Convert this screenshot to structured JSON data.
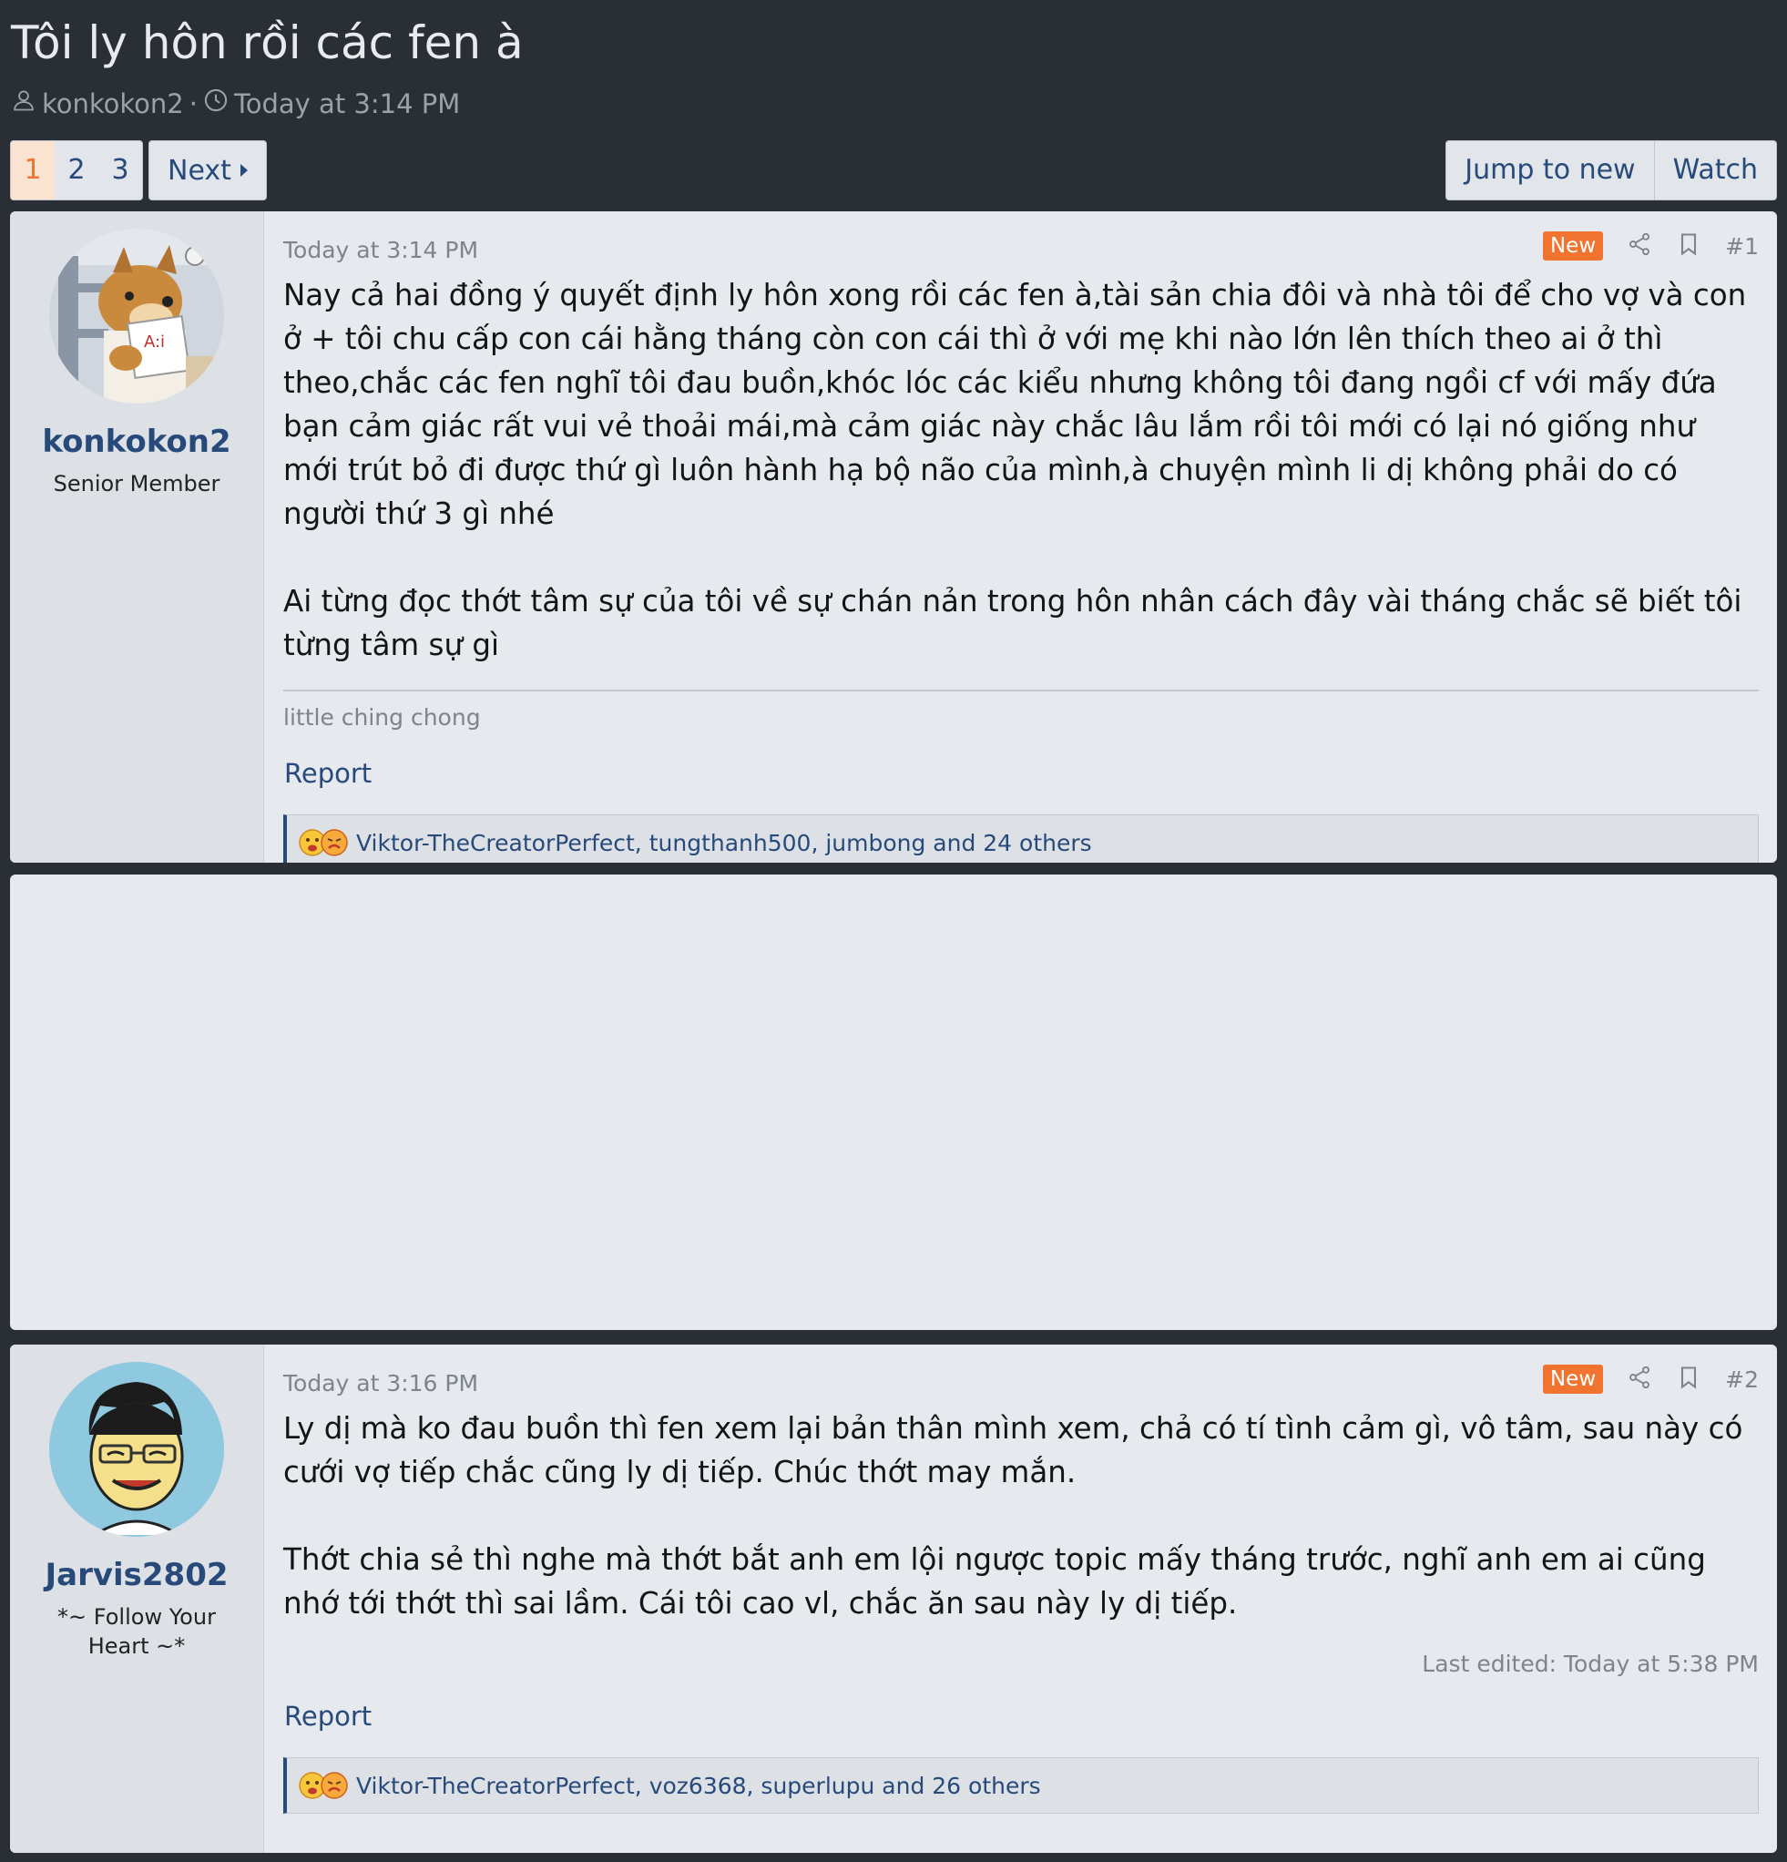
{
  "thread": {
    "title": "Tôi ly hôn rồi các fen à",
    "author": "konkokon2",
    "separator": "·",
    "time": "Today at 3:14 PM"
  },
  "pagination": {
    "pages": [
      "1",
      "2",
      "3"
    ],
    "current": "1",
    "next_label": "Next"
  },
  "actions": {
    "jump_label": "Jump to new",
    "watch_label": "Watch"
  },
  "posts": [
    {
      "username": "konkokon2",
      "user_title": "Senior Member",
      "date": "Today at 3:14 PM",
      "badge": "New",
      "number": "#1",
      "paragraphs": [
        "Nay cả hai đồng ý quyết định ly hôn xong rồi các fen à,tài sản chia đôi và nhà tôi để cho vợ và con ở + tôi chu cấp con cái hằng tháng còn con cái thì ở với mẹ khi nào lớn lên thích theo ai ở thì theo,chắc các fen nghĩ tôi đau buồn,khóc lóc các kiểu nhưng không tôi đang ngồi cf với mấy đứa bạn cảm giác rất vui vẻ thoải mái,mà cảm giác này chắc lâu lắm rồi tôi mới có lại nó giống như mới trút bỏ đi được thứ gì luôn hành hạ bộ não của mình,à chuyện mình li dị không phải do có người thứ 3 gì nhé",
        "Ai từng đọc thớt tâm sự của tôi về sự chán nản trong hôn nhân cách đây vài tháng chắc sẽ biết tôi từng tâm sự gì"
      ],
      "signature": "little ching chong",
      "report": "Report",
      "reactions": "Viktor-TheCreatorPerfect, tungthanh500, jumbong and 24 others"
    },
    {
      "username": "Jarvis2802",
      "user_title": "*~ Follow Your Heart ~*",
      "date": "Today at 3:16 PM",
      "badge": "New",
      "number": "#2",
      "paragraphs": [
        "Ly dị mà ko đau buồn thì fen xem lại bản thân mình xem, chả có tí tình cảm gì, vô tâm, sau này có cưới vợ tiếp chắc cũng ly dị tiếp. Chúc thớt may mắn.",
        "Thớt chia sẻ thì nghe mà thớt bắt anh em lội ngược topic mấy tháng trước, nghĩ anh em ai cũng nhớ tới thớt thì sai lầm. Cái tôi cao vl, chắc ăn sau này ly dị tiếp."
      ],
      "edited": "Last edited: Today at 5:38 PM",
      "report": "Report",
      "reactions": "Viktor-TheCreatorPerfect, voz6368, superlupu and 26 others"
    }
  ],
  "icons": {
    "author": "user-icon",
    "time": "clock-icon",
    "share": "share-icon",
    "bookmark": "bookmark-icon",
    "reactions": "reaction-emoji-icon"
  },
  "colors": {
    "background": "#2a2f35",
    "card": "#e6e9ed",
    "link": "#274a7b",
    "accent": "#f0742f"
  }
}
